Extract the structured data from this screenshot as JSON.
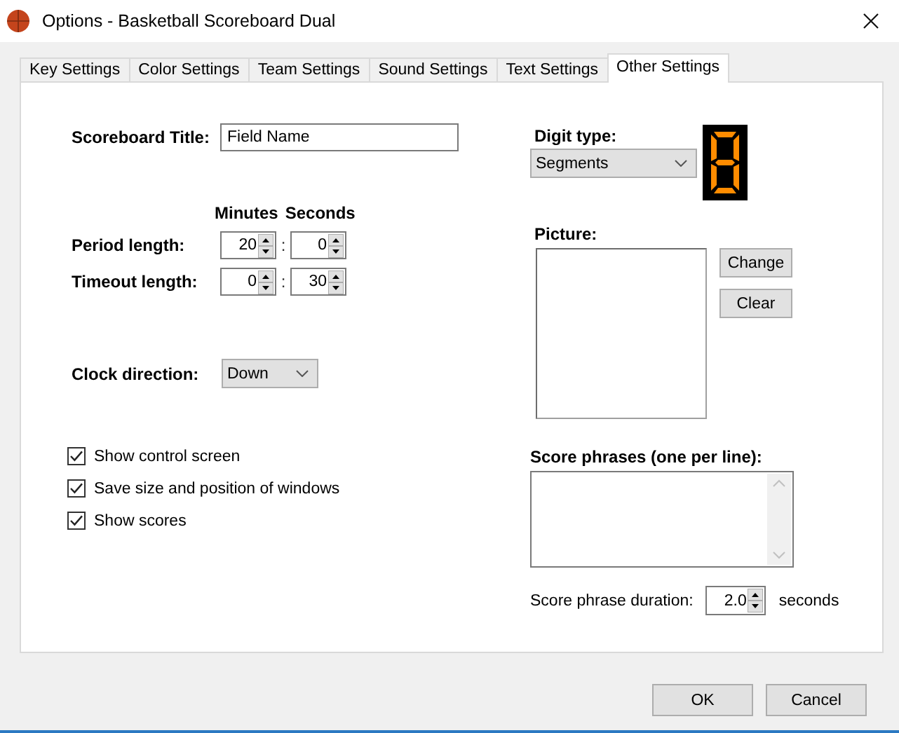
{
  "window": {
    "title": "Options - Basketball Scoreboard Dual"
  },
  "tabs": [
    {
      "label": "Key Settings",
      "selected": false
    },
    {
      "label": "Color Settings",
      "selected": false
    },
    {
      "label": "Team Settings",
      "selected": false
    },
    {
      "label": "Sound Settings",
      "selected": false
    },
    {
      "label": "Text Settings",
      "selected": false
    },
    {
      "label": "Other Settings",
      "selected": true
    }
  ],
  "scoreboard_title": {
    "label": "Scoreboard Title:",
    "value": "Field Name"
  },
  "time_columns": [
    "Minutes",
    "Seconds"
  ],
  "time_rows": [
    {
      "label": "Period length:",
      "minutes": "20",
      "separator": ":",
      "seconds": "0"
    },
    {
      "label": "Timeout length:",
      "minutes": "0",
      "separator": ":",
      "seconds": "30"
    }
  ],
  "clock_direction": {
    "label": "Clock direction:",
    "value": "Down"
  },
  "checkboxes": [
    {
      "label": "Show control screen",
      "checked": true
    },
    {
      "label": "Save size and position of windows",
      "checked": true
    },
    {
      "label": "Show scores",
      "checked": true
    }
  ],
  "digit_type": {
    "label": "Digit type:",
    "value": "Segments"
  },
  "picture": {
    "label": "Picture:",
    "buttons": [
      "Change",
      "Clear"
    ]
  },
  "score_phrases": {
    "label": "Score phrases (one per line):"
  },
  "score_phrase_duration": {
    "label": "Score phrase duration:",
    "value": "2.0",
    "unit": "seconds"
  },
  "buttons": [
    "OK",
    "Cancel"
  ]
}
